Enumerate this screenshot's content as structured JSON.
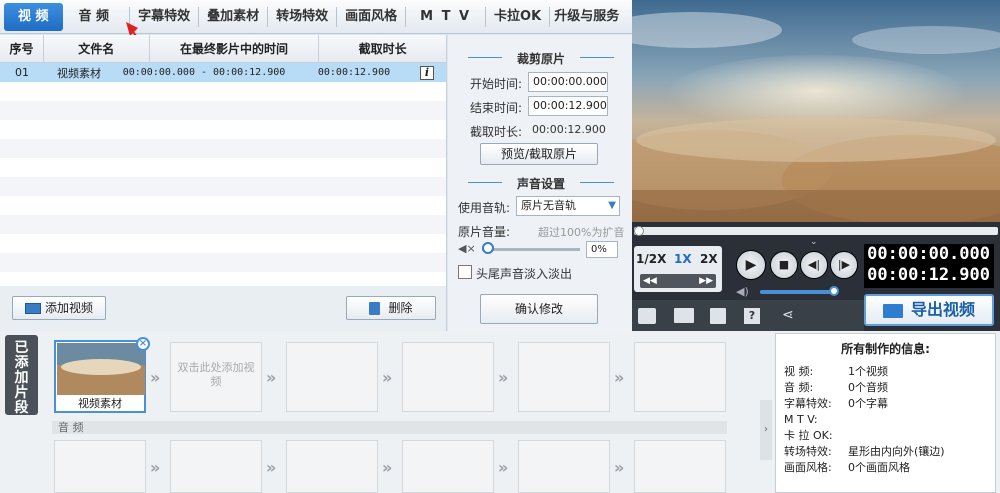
{
  "tabs": [
    "视 频",
    "音 频",
    "字幕特效",
    "叠加素材",
    "转场特效",
    "画面风格",
    "M T V",
    "卡拉OK",
    "升级与服务"
  ],
  "table": {
    "headers": [
      "序号",
      "文件名",
      "在最终影片中的时间",
      "截取时长"
    ],
    "rows": [
      {
        "index": "01",
        "name": "视频素材",
        "range": "00:00:00.000 - 00:00:12.900",
        "duration": "00:00:12.900"
      }
    ],
    "info_icon": "i"
  },
  "buttons": {
    "add_video": "添加视频",
    "delete": "删除",
    "preview_trim": "预览/截取原片",
    "confirm": "确认修改",
    "export": "导出视频"
  },
  "trim": {
    "title": "裁剪原片",
    "start_label": "开始时间:",
    "start_value": "00:00:00.000",
    "end_label": "结束时间:",
    "end_value": "00:00:12.900",
    "duration_label": "截取时长:",
    "duration_value": "00:00:12.900"
  },
  "sound": {
    "title": "声音设置",
    "track_label": "使用音轨:",
    "track_value": "原片无音轨",
    "volume_label": "原片音量:",
    "volume_hint": "超过100%为扩音",
    "volume_value": "0%",
    "fade_label": "头尾声音淡入淡出"
  },
  "player": {
    "speeds": [
      "1/2X",
      "1X",
      "2X"
    ],
    "time_current": "00:00:00.000",
    "time_total": "00:00:12.900",
    "volume_level": 0.95
  },
  "timeline": {
    "sidetab": "已添加片段",
    "clip_label": "视频素材",
    "placeholder": "双击此处添加视频",
    "audio_label": "音 频"
  },
  "info": {
    "title": "所有制作的信息:",
    "rows": [
      {
        "k": "视    频:",
        "v": "1个视频"
      },
      {
        "k": "音    频:",
        "v": "0个音频"
      },
      {
        "k": "字幕特效:",
        "v": "0个字幕"
      },
      {
        "k": "M T V:",
        "v": ""
      },
      {
        "k": "卡  拉 OK:",
        "v": ""
      },
      {
        "k": "转场特效:",
        "v": "星形由内向外(镶边)"
      },
      {
        "k": "画面风格:",
        "v": "0个画面风格"
      }
    ]
  },
  "colors": {
    "accent": "#1f6cc4",
    "selection": "#b9dcf6",
    "player_bg": "#2b3038"
  }
}
